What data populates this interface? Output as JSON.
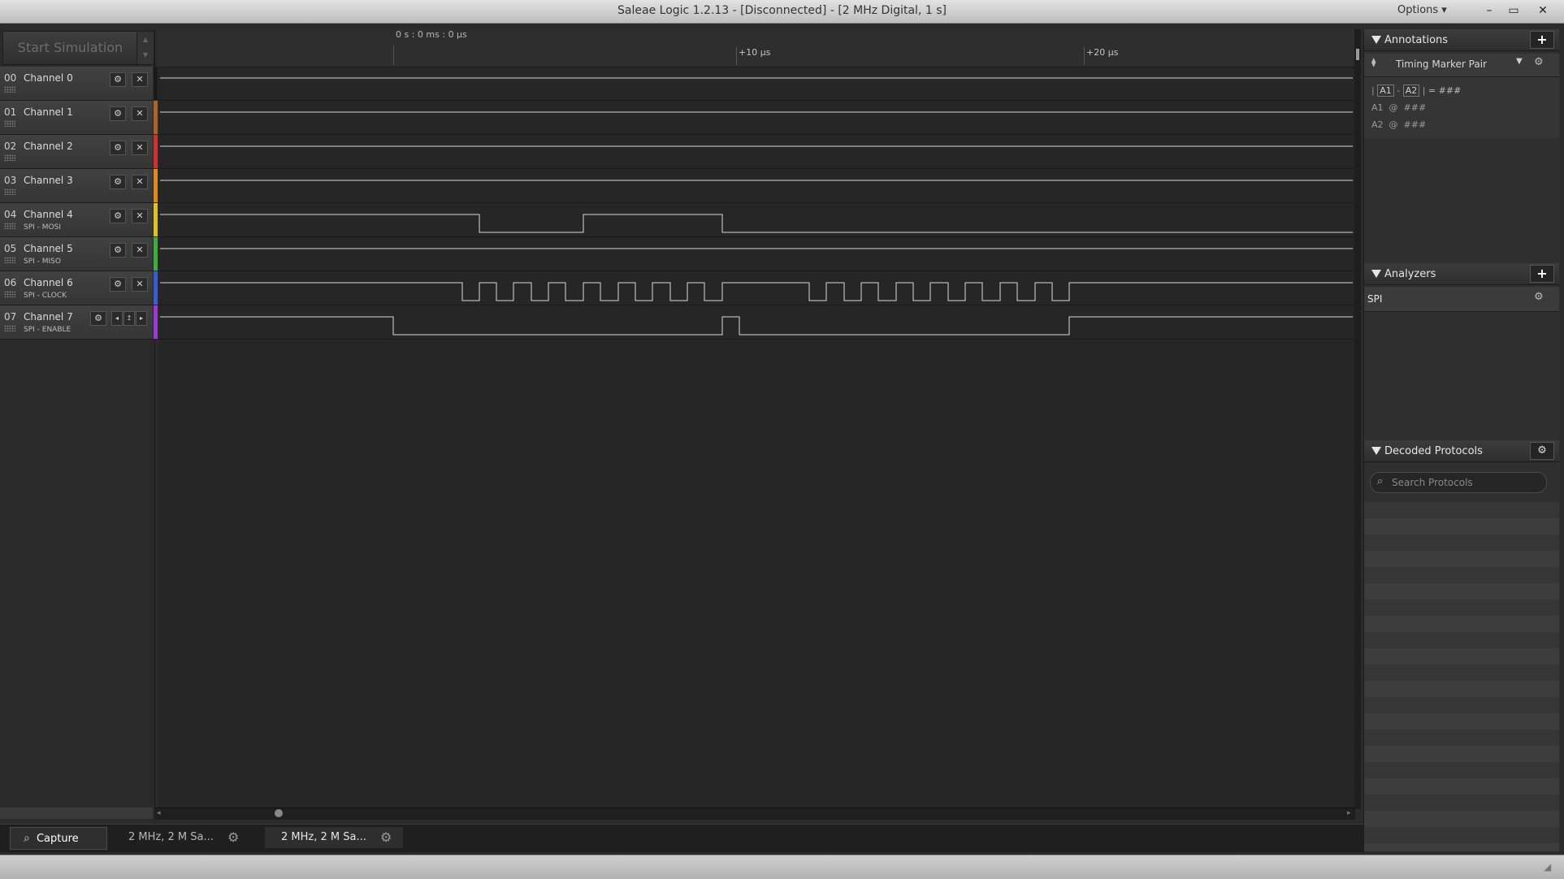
{
  "window": {
    "title": "Saleae Logic 1.2.13 - [Disconnected] - [2 MHz Digital, 1 s]",
    "options_label": "Options ▾",
    "minimize_glyph": "–",
    "restore_glyph": "▭",
    "close_glyph": "✕"
  },
  "sim_button_label": "Start Simulation",
  "ruler": {
    "origin_label": "0 s : 0 ms : 0 µs",
    "tick_labels": [
      "+10 µs",
      "+20 µs"
    ]
  },
  "channels": [
    {
      "num": "00",
      "name": "Channel 0",
      "sub": "",
      "color": "#1a1a1a"
    },
    {
      "num": "01",
      "name": "Channel 1",
      "sub": "",
      "color": "#b0602a"
    },
    {
      "num": "02",
      "name": "Channel 2",
      "sub": "",
      "color": "#d03030"
    },
    {
      "num": "03",
      "name": "Channel 3",
      "sub": "",
      "color": "#e08a1e"
    },
    {
      "num": "04",
      "name": "Channel 4",
      "sub": "SPI - MOSI",
      "color": "#e0c21e"
    },
    {
      "num": "05",
      "name": "Channel 5",
      "sub": "SPI - MISO",
      "color": "#3cae3c"
    },
    {
      "num": "06",
      "name": "Channel 6",
      "sub": "SPI - CLOCK",
      "color": "#3a5ad8"
    },
    {
      "num": "07",
      "name": "Channel 7",
      "sub": "SPI - ENABLE",
      "color": "#9a3ad0"
    }
  ],
  "icons": {
    "gear": "⚙",
    "close": "✕",
    "prev": "◂",
    "trigger": "↥",
    "next": "▸",
    "search": "⌕",
    "marker": "⧫"
  },
  "tabs": {
    "capture_label": "Capture",
    "session1_label": "2 MHz, 2 M Sa...",
    "session2_label": "2 MHz, 2 M Sa..."
  },
  "annotations": {
    "title": "Annotations",
    "marker_label": "Timing Marker Pair",
    "line1_a1": "A1",
    "line1_sep": "-",
    "line1_a2": "A2",
    "line1_eq": "= ###",
    "line2": "A1  @  ###",
    "line3": "A2  @  ###"
  },
  "analyzers": {
    "title": "Analyzers",
    "items": [
      "SPI"
    ]
  },
  "decoded": {
    "title": "Decoded Protocols",
    "search_placeholder": "Search Protocols"
  }
}
